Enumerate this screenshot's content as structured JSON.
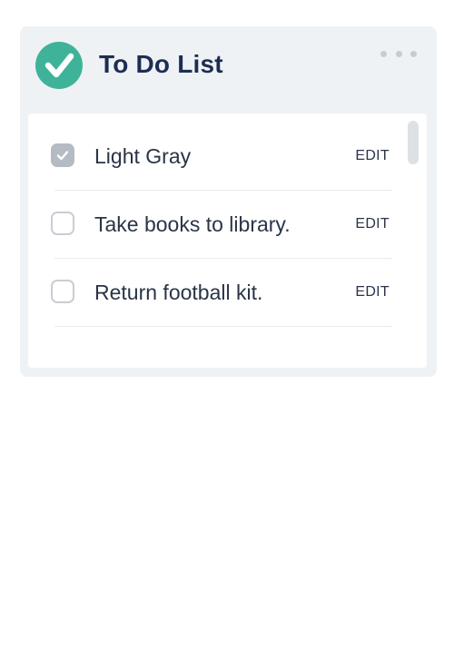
{
  "widget": {
    "title": "To Do List",
    "logo_icon": "check-circle-icon",
    "menu_icon": "more-horizontal-icon",
    "accent_color": "#3fb39a",
    "title_color": "#1d2d52"
  },
  "todos": [
    {
      "label": "Light Gray",
      "checked": true,
      "edit_label": "EDIT"
    },
    {
      "label": "Take books to library.",
      "checked": false,
      "edit_label": "EDIT"
    },
    {
      "label": "Return football kit.",
      "checked": false,
      "edit_label": "EDIT"
    }
  ]
}
